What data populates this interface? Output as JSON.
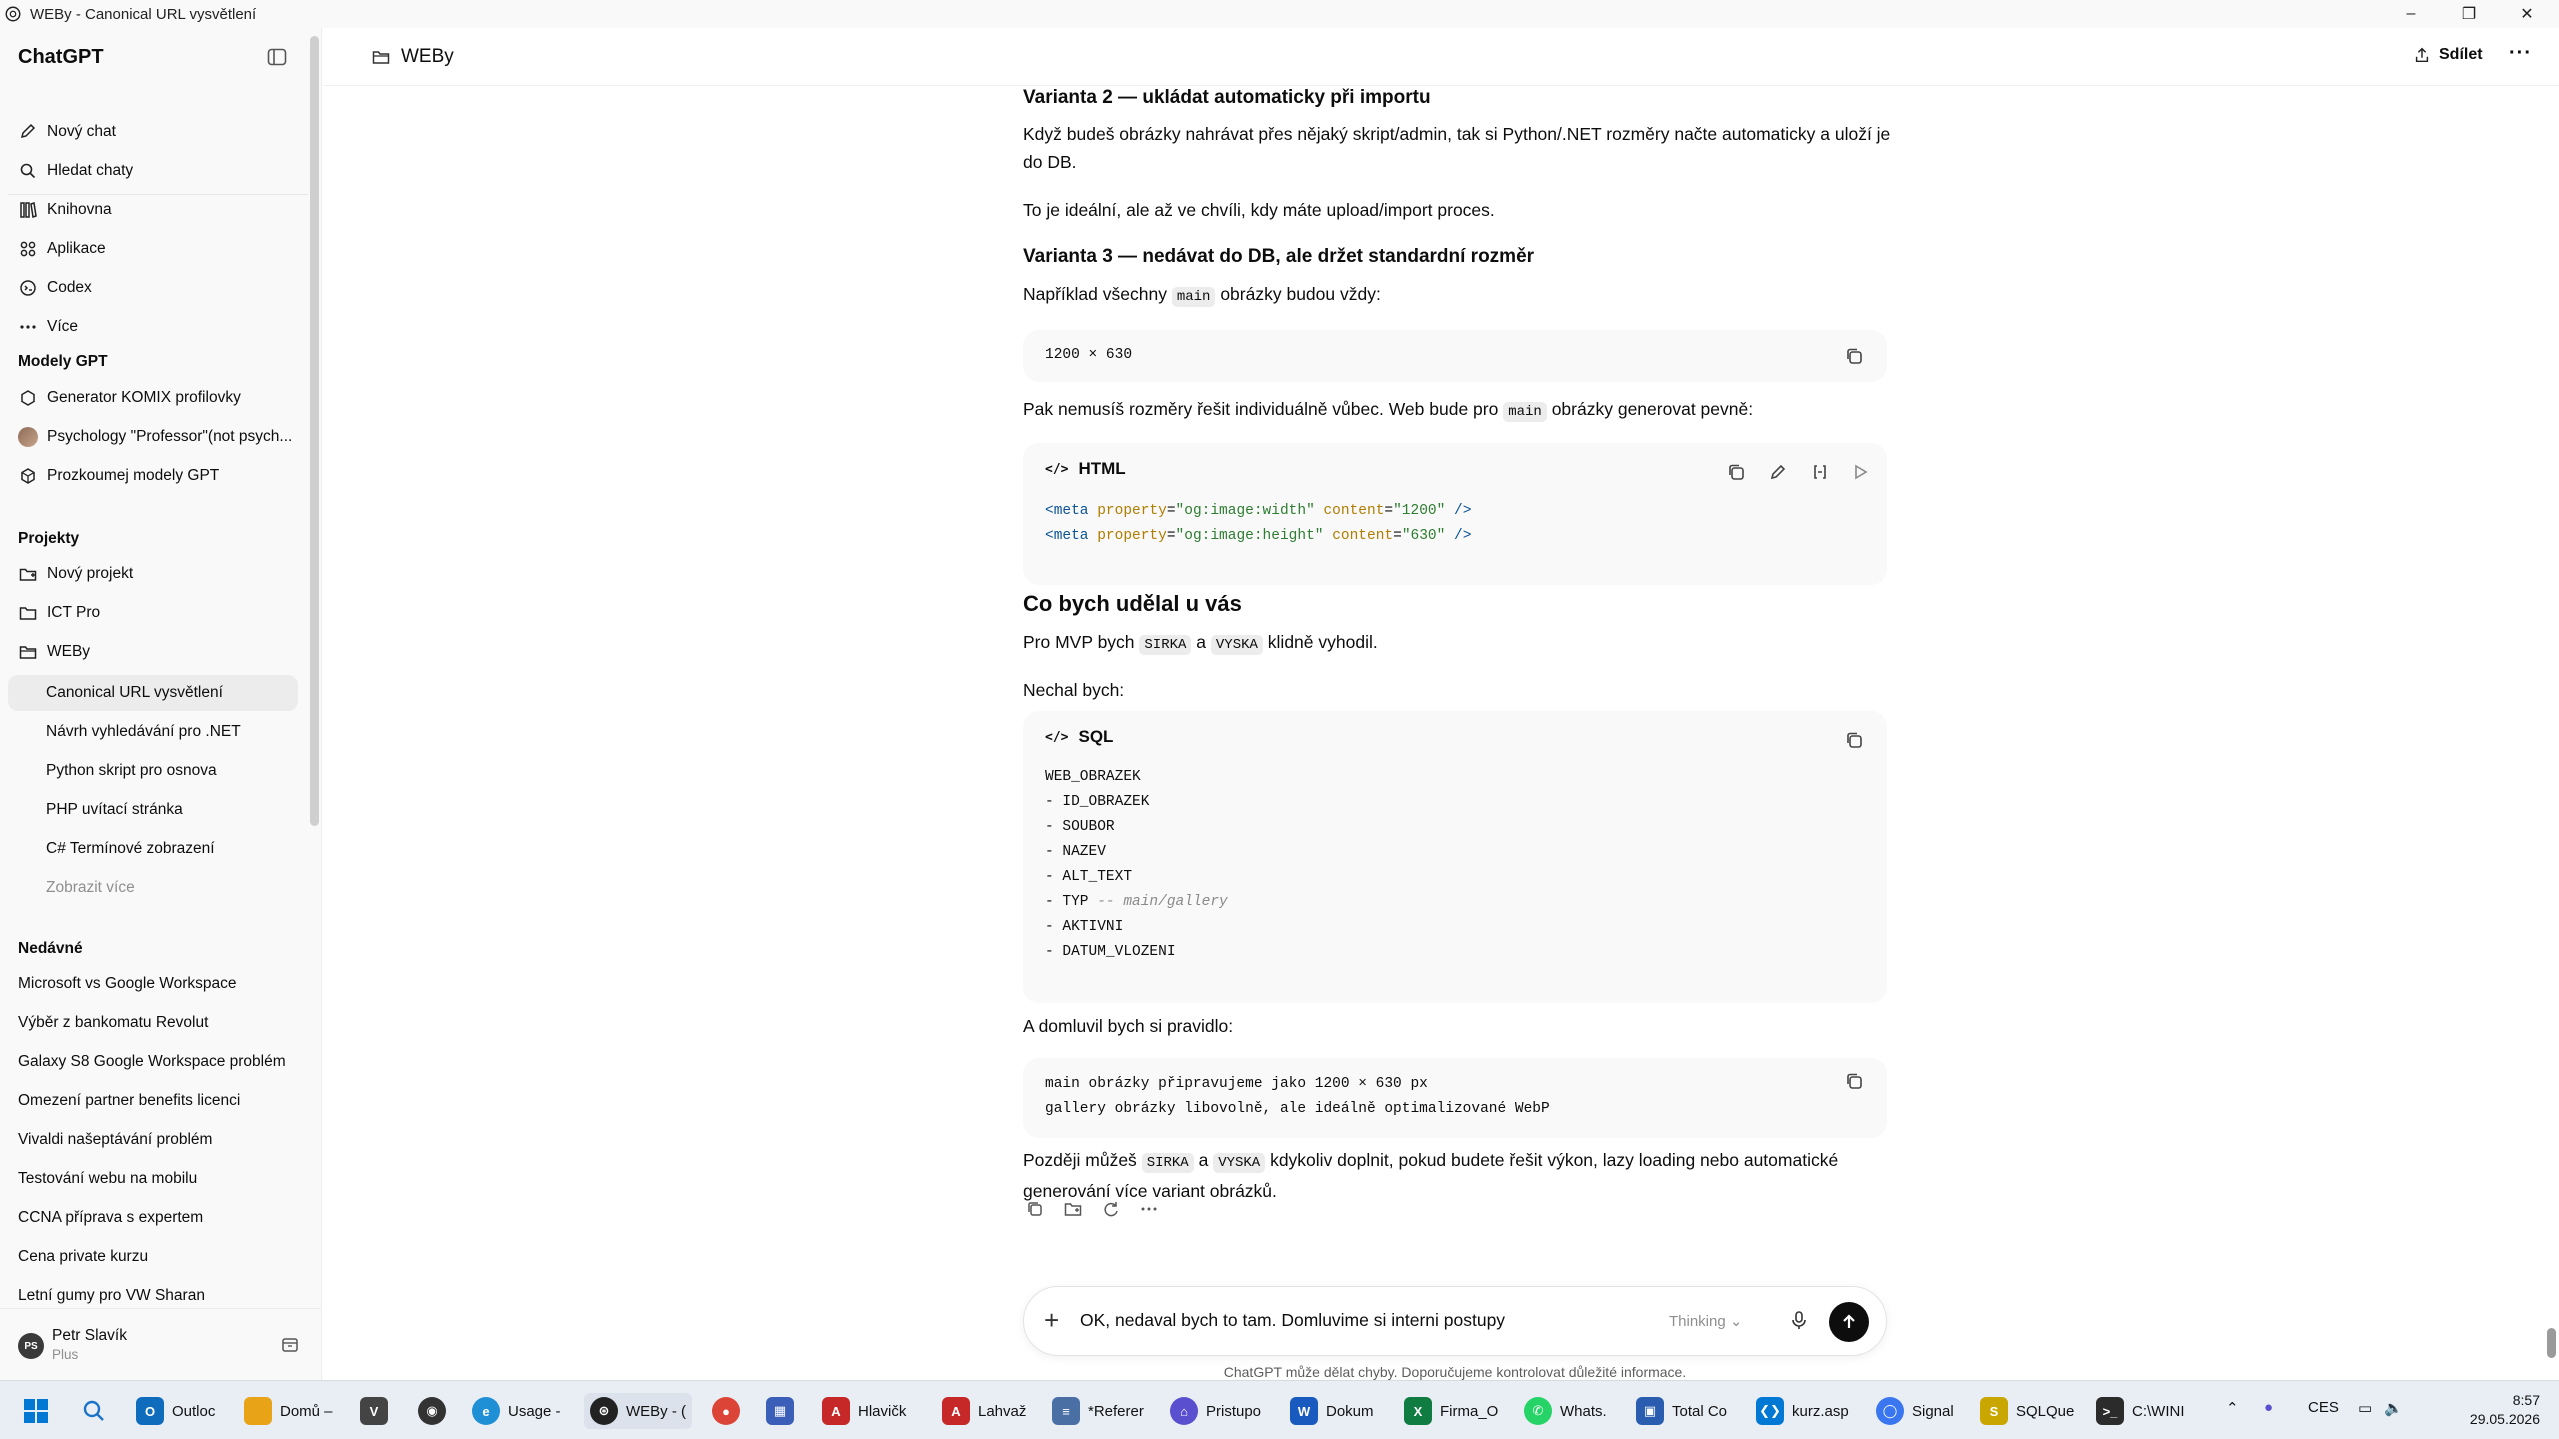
{
  "window": {
    "title": "WEBy - Canonical URL vysvětlení"
  },
  "sidebar": {
    "brand": "ChatGPT",
    "nav": [
      {
        "label": "Nový chat",
        "icon": "new-chat-icon"
      },
      {
        "label": "Hledat chaty",
        "icon": "search-icon"
      },
      {
        "label": "Knihovna",
        "icon": "library-icon"
      },
      {
        "label": "Aplikace",
        "icon": "apps-icon"
      },
      {
        "label": "Codex",
        "icon": "codex-icon"
      },
      {
        "label": "Více",
        "icon": "more-icon"
      }
    ],
    "gpts_heading": "Modely GPT",
    "gpts": [
      {
        "label": "Generator KOMIX profilovky",
        "icon": "gpt-icon"
      },
      {
        "label": "Psychology \"Professor\"(not psych...",
        "icon": "avatar"
      },
      {
        "label": "Prozkoumej modely GPT",
        "icon": "explore-icon"
      }
    ],
    "projects_heading": "Projekty",
    "projects": [
      {
        "label": "Nový projekt",
        "icon": "new-folder-icon"
      },
      {
        "label": "ICT Pro",
        "icon": "folder-icon"
      },
      {
        "label": "WEBy",
        "icon": "folder-open-icon"
      }
    ],
    "project_chats": [
      {
        "label": "Canonical URL vysvětlení",
        "active": true
      },
      {
        "label": "Návrh vyhledávání pro .NET"
      },
      {
        "label": "Python skript pro osnova"
      },
      {
        "label": "PHP uvítací stránka"
      },
      {
        "label": "C# Termínové zobrazení"
      },
      {
        "label": "Zobrazit více",
        "muted": true
      }
    ],
    "recent_heading": "Nedávné",
    "recent": [
      "Microsoft vs Google Workspace",
      "Výběr z bankomatu Revolut",
      "Galaxy S8 Google Workspace problém",
      "Omezení partner benefits licenci",
      "Vivaldi našeptávání problém",
      "Testování webu na mobilu",
      "CCNA příprava s expertem",
      "Cena private kurzu",
      "Letní gumy pro VW Sharan"
    ],
    "user": {
      "initials": "PS",
      "name": "Petr Slavík",
      "plan": "Plus"
    }
  },
  "header": {
    "project": "WEBy",
    "share": "Sdílet",
    "more": "···"
  },
  "content": {
    "v2_heading": "Varianta 2 — ukládat automaticky při importu",
    "v2_p1": "Když budeš obrázky nahrávat přes nějaký skript/admin, tak si Python/.NET rozměry načte automaticky a uloží je do DB.",
    "v2_p2": "To je ideální, ale až ve chvíli, kdy máte upload/import proces.",
    "v3_heading": "Varianta 3 — nedávat do DB, ale držet standardní rozměr",
    "v3_p1_a": "Například všechny",
    "v3_p1_code": "main",
    "v3_p1_b": "obrázky budou vždy:",
    "size_code": "1200 × 630",
    "p3_a": "Pak nemusíš rozměry řešit individuálně vůbec. Web bude pro",
    "p3_code": "main",
    "p3_b": "obrázky generovat pevně:",
    "html_block": {
      "lang": "HTML",
      "line1": {
        "open": "<meta",
        "attr1": "property",
        "val1": "\"og:image:width\"",
        "attr2": "content",
        "val2": "\"1200\"",
        "close": "/>"
      },
      "line2": {
        "open": "<meta",
        "attr1": "property",
        "val1": "\"og:image:height\"",
        "attr2": "content",
        "val2": "\"630\"",
        "close": "/>"
      }
    },
    "cbu_heading": "Co bych udělal u vás",
    "cbu_p1_a": "Pro MVP bych",
    "cbu_p1_c1": "SIRKA",
    "cbu_p1_b": "a",
    "cbu_p1_c2": "VYSKA",
    "cbu_p1_c": "klidně vyhodil.",
    "cbu_p2": "Nechal bych:",
    "sql_block": {
      "lang": "SQL",
      "lines": [
        "WEB_OBRAZEK",
        "- ID_OBRAZEK",
        "- SOUBOR",
        "- NAZEV",
        "- ALT_TEXT",
        "- TYP",
        "- AKTIVNI",
        "- DATUM_VLOZENI"
      ],
      "typ_comment": "-- main/gallery"
    },
    "rule_p": "A domluvil bych si pravidlo:",
    "rule_block": {
      "line1": "main obrázky připravujeme jako 1200 × 630 px",
      "line2": "gallery obrázky libovolně, ale ideálně optimalizované WebP"
    },
    "final_a": "Později můžeš",
    "final_c1": "SIRKA",
    "final_b": "a",
    "final_c2": "VYSKA",
    "final_c": "kdykoliv doplnit, pokud budete řešit výkon, lazy loading nebo automatické generování více variant obrázků."
  },
  "composer": {
    "value": "OK, nedaval bych to tam. Domluvime si interni postupy",
    "model": "Thinking",
    "disclaimer": "ChatGPT může dělat chyby. Doporučujeme kontrolovat důležité informace."
  },
  "taskbar": {
    "apps": [
      {
        "label": "Outloc",
        "color": "#0f6cbd",
        "icon": "outlook-icon"
      },
      {
        "label": "Domů –",
        "color": "#e8a317",
        "icon": "explorer-icon"
      },
      {
        "label": "",
        "color": "#444444",
        "icon": "app-icon"
      },
      {
        "label": "",
        "color": "#333333",
        "icon": "eye-app-icon"
      },
      {
        "label": "Usage -",
        "color": "#1f8fd6",
        "icon": "edge-icon"
      },
      {
        "label": "WEBy - (",
        "color": "#222222",
        "icon": "chatgpt-icon",
        "active": true
      },
      {
        "label": "",
        "color": "#db4437",
        "icon": "chrome-icon"
      },
      {
        "label": "",
        "color": "#3b5fb8",
        "icon": "app2-icon"
      },
      {
        "label": "Hlavičk",
        "color": "#c62828",
        "icon": "pdf-icon"
      },
      {
        "label": "Lahvaž",
        "color": "#c62828",
        "icon": "pdf2-icon"
      },
      {
        "label": "*Referer",
        "color": "#4a6fa5",
        "icon": "notepad-icon"
      },
      {
        "label": "Pristupo",
        "color": "#5a4fcf",
        "icon": "app3-icon"
      },
      {
        "label": "Dokum",
        "color": "#185abd",
        "icon": "word-icon"
      },
      {
        "label": "Firma_O",
        "color": "#107c41",
        "icon": "excel-icon"
      },
      {
        "label": "Whats.",
        "color": "#25d366",
        "icon": "whatsapp-icon"
      },
      {
        "label": "Total Co",
        "color": "#2a5db0",
        "icon": "totalcmd-icon"
      },
      {
        "label": "kurz.asp",
        "color": "#0078d4",
        "icon": "vscode-icon"
      },
      {
        "label": "Signal",
        "color": "#3a76f0",
        "icon": "signal-icon"
      },
      {
        "label": "SQLQue",
        "color": "#c9a700",
        "icon": "sql-icon"
      },
      {
        "label": "C:\\WINI",
        "color": "#2b2b2b",
        "icon": "terminal-icon"
      }
    ],
    "lang": "CES",
    "time": "8:57",
    "date": "29.05.2026"
  }
}
